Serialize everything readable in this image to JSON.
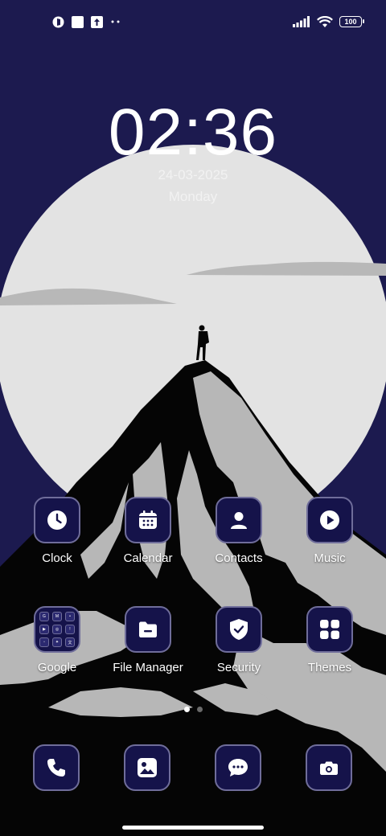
{
  "status_bar": {
    "left_icons": [
      "notification-app-icon",
      "square-notification-icon",
      "upload-notification-icon",
      "more-notifications-icon"
    ],
    "right_icons": [
      "signal-icon",
      "wifi-icon",
      "battery-icon"
    ],
    "battery_level": "100"
  },
  "lockclock": {
    "time": "02:36",
    "date": "24-03-2025",
    "day": "Monday"
  },
  "apps": [
    {
      "label": "Clock",
      "icon": "clock-icon"
    },
    {
      "label": "Calendar",
      "icon": "calendar-icon"
    },
    {
      "label": "Contacts",
      "icon": "contacts-icon"
    },
    {
      "label": "Music",
      "icon": "music-icon"
    },
    {
      "label": "Google",
      "icon": "google-folder-icon"
    },
    {
      "label": "File Manager",
      "icon": "folder-icon"
    },
    {
      "label": "Security",
      "icon": "shield-icon"
    },
    {
      "label": "Themes",
      "icon": "themes-icon"
    }
  ],
  "dock": [
    {
      "icon": "phone-icon"
    },
    {
      "icon": "gallery-icon"
    },
    {
      "icon": "messages-icon"
    },
    {
      "icon": "camera-icon"
    }
  ],
  "page_indicator": {
    "pages": 2,
    "current": 1
  },
  "colors": {
    "sky": "#1c1a4f",
    "moon": "#e3e3e3",
    "mountain_dark": "#050505",
    "mountain_light": "#b7b7b7",
    "tile": "#15134a",
    "tile_border": "#6f6d9a"
  }
}
